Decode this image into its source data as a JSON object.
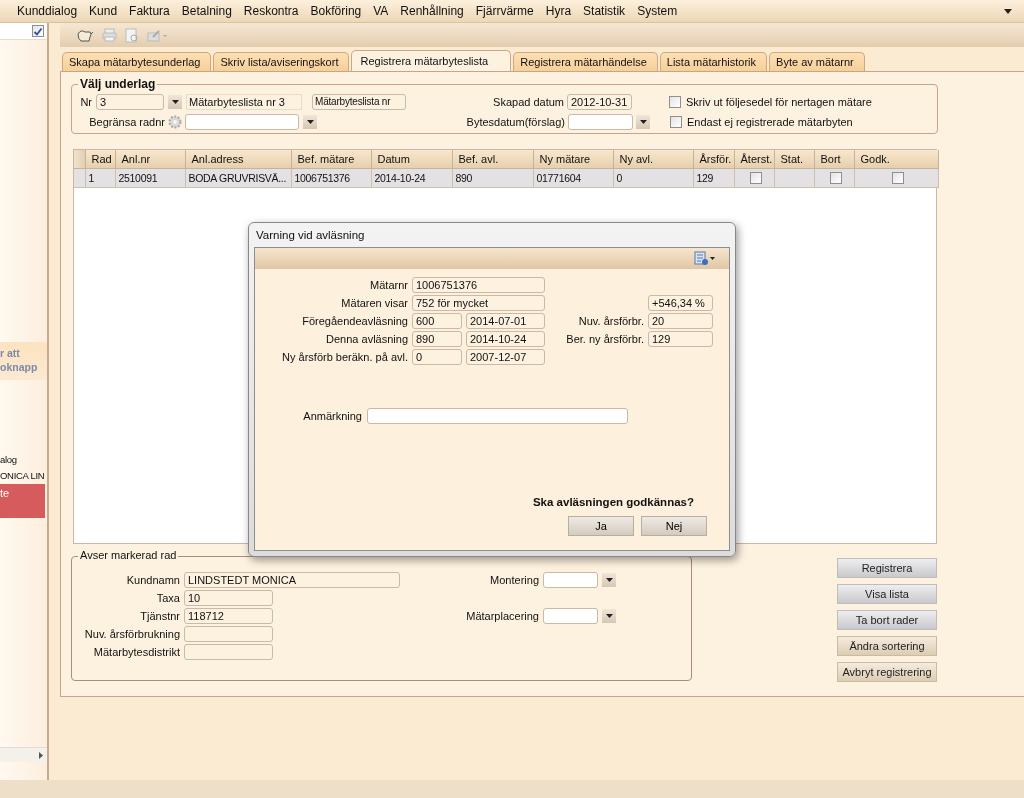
{
  "menu": [
    "Kunddialog",
    "Kund",
    "Faktura",
    "Betalning",
    "Reskontra",
    "Bokföring",
    "VA",
    "Renhållning",
    "Fjärrvärme",
    "Hyra",
    "Statistik",
    "System"
  ],
  "sidebar": {
    "checked": true,
    "items": [
      {
        "kind": "hint",
        "text": "r att"
      },
      {
        "kind": "hint",
        "text": "oknapp"
      },
      {
        "kind": "label",
        "text": "alog"
      },
      {
        "kind": "label",
        "text": "ONICA LIN"
      },
      {
        "kind": "alert",
        "text": "te"
      }
    ]
  },
  "tabs": [
    {
      "label": "Skapa mätarbytesunderlag",
      "selected": false
    },
    {
      "label": "Skriv lista/aviseringskort",
      "selected": false
    },
    {
      "label": "Registrera mätarbyteslista",
      "selected": true
    },
    {
      "label": "Registrera mätarhändelse",
      "selected": false
    },
    {
      "label": "Lista mätarhistorik",
      "selected": false
    },
    {
      "label": "Byte av mätarnr",
      "selected": false
    }
  ],
  "select_group": {
    "title": "Välj underlag",
    "nr_label": "Nr",
    "nr_value": "3",
    "list_name": "Mätarbyteslista nr 3",
    "list_name_field": "Mätarbyteslista nr",
    "limit_label": "Begränsa radnr",
    "created_label": "Skapad datum",
    "created_value": "2012-10-31",
    "change_date_label": "Bytesdatum(förslag)",
    "checkboxes": [
      {
        "label": "Skriv ut följesedel för nertagen mätare",
        "checked": false
      },
      {
        "label": "Endast ej registrerade mätarbyten",
        "checked": false
      }
    ]
  },
  "table": {
    "columns": [
      "Rad",
      "Anl.nr",
      "Anl.adress",
      "Bef. mätare",
      "Datum",
      "Bef. avl.",
      "Ny mätare",
      "Ny avl.",
      "Årsför.",
      "Återst.",
      "Stat.",
      "Bort",
      "Godk."
    ],
    "rows": [
      {
        "selected": true,
        "cells": [
          {
            "kind": "text",
            "text": "1"
          },
          {
            "kind": "text",
            "text": "2510091"
          },
          {
            "kind": "text",
            "text": "BODA GRUVRISVÄ..."
          },
          {
            "kind": "text",
            "text": "1006751376"
          },
          {
            "kind": "text",
            "text": "2014-10-24"
          },
          {
            "kind": "text",
            "text": "890"
          },
          {
            "kind": "text",
            "text": "01771604"
          },
          {
            "kind": "text",
            "text": "0"
          },
          {
            "kind": "text",
            "text": "129"
          },
          {
            "kind": "check",
            "checked": false
          },
          {
            "kind": "empty"
          },
          {
            "kind": "check",
            "checked": false
          },
          {
            "kind": "check",
            "checked": false
          }
        ]
      }
    ]
  },
  "details": {
    "title": "Avser markerad rad",
    "fields": [
      {
        "label": "Kundnamn",
        "value": "LINDSTEDT MONICA"
      },
      {
        "label": "Taxa",
        "value": "10"
      },
      {
        "label": "Tjänstnr",
        "value": "118712"
      },
      {
        "label": "Nuv. årsförbrukning"
      },
      {
        "label": "Mätarbytesdistrikt"
      }
    ],
    "dropdowns": [
      {
        "label": "Montering"
      },
      {
        "label": "Mätarplacering"
      }
    ]
  },
  "buttons": [
    {
      "label": "Registrera",
      "kind": "action"
    },
    {
      "label": "Visa lista",
      "kind": "action"
    },
    {
      "label": "Ta bort rader",
      "kind": "action"
    },
    {
      "label": "Ändra sortering",
      "kind": "sort"
    },
    {
      "label": "Avbryt registrering",
      "kind": "sort"
    }
  ],
  "dialog": {
    "title": "Varning vid avläsning",
    "rows": [
      {
        "label": "Mätarnr",
        "value": "1006751376"
      },
      {
        "label": "Mätaren visar",
        "value": "752 för mycket",
        "right_value": "+546,34 %"
      },
      {
        "label": "Föregåendeavläsning",
        "value": "600",
        "date": "2014-07-01",
        "right_label": "Nuv. årsförbr.",
        "right_value": "20"
      },
      {
        "label": "Denna avläsning",
        "value": "890",
        "date": "2014-10-24",
        "right_label": "Ber. ny årsförbr.",
        "right_value": "129"
      },
      {
        "label": "Ny årsförb beräkn. på avl.",
        "value": "0",
        "date": "2007-12-07"
      }
    ],
    "remark_label": "Anmärkning",
    "question": "Ska avläsningen godkännas?",
    "buttons": [
      "Ja",
      "Nej"
    ]
  }
}
